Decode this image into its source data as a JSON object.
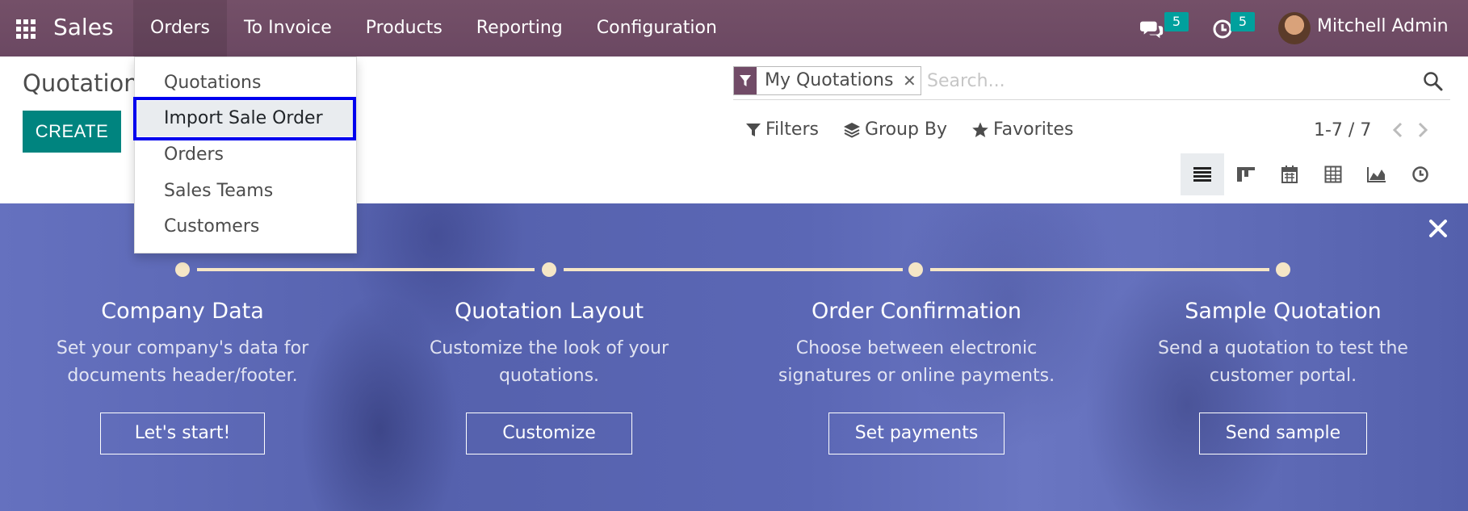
{
  "navbar": {
    "app_name": "Sales",
    "menu": [
      {
        "label": "Orders",
        "active": true
      },
      {
        "label": "To Invoice"
      },
      {
        "label": "Products"
      },
      {
        "label": "Reporting"
      },
      {
        "label": "Configuration"
      }
    ],
    "messages_count": "5",
    "activities_count": "5",
    "user_name": "Mitchell Admin"
  },
  "orders_dropdown": {
    "items": [
      "Quotations",
      "Import Sale Order",
      "Orders",
      "Sales Teams",
      "Customers"
    ],
    "highlighted": "Import Sale Order"
  },
  "control_panel": {
    "title": "Quotations",
    "create_label": "CREATE",
    "search": {
      "facet_label": "My Quotations",
      "placeholder": "Search..."
    },
    "filters_label": "Filters",
    "group_by_label": "Group By",
    "favorites_label": "Favorites",
    "pager": "1-7 / 7",
    "views": [
      "list",
      "kanban",
      "calendar",
      "pivot",
      "graph",
      "activity"
    ],
    "active_view": "list"
  },
  "onboarding": {
    "steps": [
      {
        "title": "Company Data",
        "desc1": "Set your company's data for",
        "desc2": "documents header/footer.",
        "button": "Let's start!"
      },
      {
        "title": "Quotation Layout",
        "desc1": "Customize the look of your",
        "desc2": "quotations.",
        "button": "Customize"
      },
      {
        "title": "Order Confirmation",
        "desc1": "Choose between electronic",
        "desc2": "signatures or online payments.",
        "button": "Set payments"
      },
      {
        "title": "Sample Quotation",
        "desc1": "Send a quotation to test the",
        "desc2": "customer portal.",
        "button": "Send sample"
      }
    ]
  },
  "colors": {
    "navbar": "#71506a",
    "primary": "#00847f",
    "badge": "#00a09d",
    "highlight_border": "#0000ee",
    "banner": "#5a67b3",
    "step_line": "#f5e6c6"
  }
}
